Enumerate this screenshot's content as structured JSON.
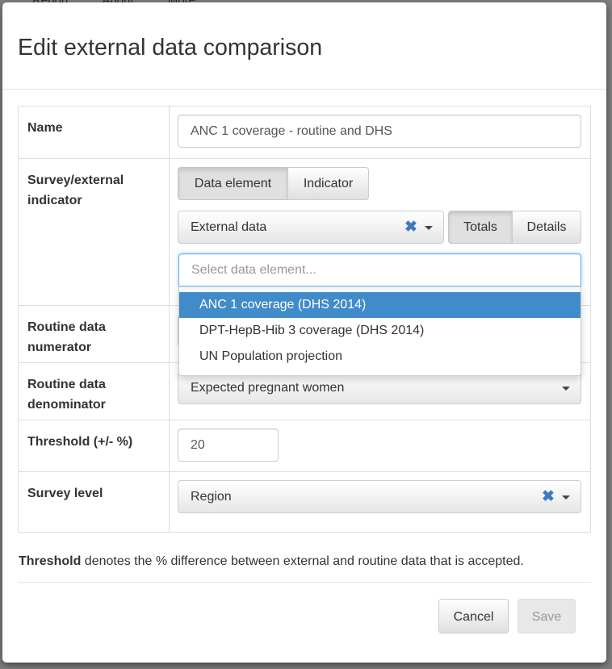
{
  "background": {
    "nav_items": [
      "Report",
      "About",
      "More"
    ]
  },
  "dialog": {
    "title": "Edit external data comparison",
    "rows": {
      "name": {
        "label": "Name",
        "value": "ANC 1 coverage - routine and DHS"
      },
      "survey": {
        "label": "Survey/external indicator",
        "toggle_data_element": "Data element",
        "toggle_indicator": "Indicator",
        "group_select": "External data",
        "toggle_totals": "Totals",
        "toggle_details": "Details",
        "search_placeholder": "Select data element...",
        "options": [
          "ANC 1 coverage (DHS 2014)",
          "DPT-HepB-Hib 3 coverage (DHS 2014)",
          "UN Population projection"
        ],
        "selected_option": "ANC 1 coverage (DHS 2014)"
      },
      "numerator": {
        "label": "Routine data numerator"
      },
      "denominator": {
        "label": "Routine data denominator",
        "value": "Expected pregnant women"
      },
      "threshold": {
        "label": "Threshold (+/- %)",
        "value": "20"
      },
      "survey_level": {
        "label": "Survey level",
        "value": "Region"
      }
    },
    "hint_bold": "Threshold",
    "hint_text": " denotes the % difference between external and routine data that is accepted.",
    "cancel_label": "Cancel",
    "save_label": "Save"
  },
  "colors": {
    "accent": "#428bca",
    "clear_icon": "#3c7ac0"
  }
}
